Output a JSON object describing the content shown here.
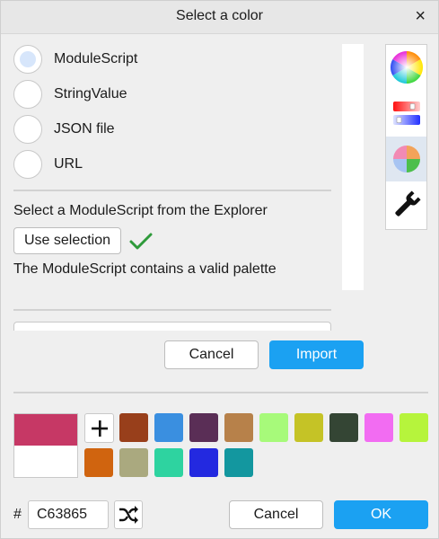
{
  "window": {
    "title": "Select a color",
    "close_label": "×"
  },
  "import_sources": [
    {
      "label": "ModuleScript",
      "selected": true
    },
    {
      "label": "StringValue",
      "selected": false
    },
    {
      "label": "JSON file",
      "selected": false
    },
    {
      "label": "URL",
      "selected": false
    }
  ],
  "module_section": {
    "instruction": "Select a ModuleScript from the Explorer",
    "use_selection_label": "Use selection",
    "status_text": "The ModuleScript contains a valid palette",
    "status_icon": "checkmark-icon",
    "status_color": "#2e9a3a"
  },
  "dialog_buttons": {
    "cancel": "Cancel",
    "import": "Import"
  },
  "modes": [
    {
      "icon": "color-wheel-icon",
      "active": false
    },
    {
      "icon": "color-sliders-icon",
      "active": false
    },
    {
      "icon": "palette-icon",
      "active": true
    },
    {
      "icon": "wrench-icon",
      "active": false
    }
  ],
  "current_color": {
    "hex": "C63865",
    "preview": "#C63865",
    "previous": "#FFFFFF"
  },
  "swatches": [
    "#983F1B",
    "#3A8FE0",
    "#5A2E56",
    "#B7814A",
    "#A7FA7A",
    "#C5C326",
    "#344534",
    "#F26CF2",
    "#B6F43C",
    "#D0640F",
    "#AAA97F",
    "#2ED3A0",
    "#2329E0",
    "#13979F"
  ],
  "footer": {
    "hash_label": "#",
    "cancel": "Cancel",
    "ok": "OK"
  },
  "accent_color": "#1BA1F2"
}
